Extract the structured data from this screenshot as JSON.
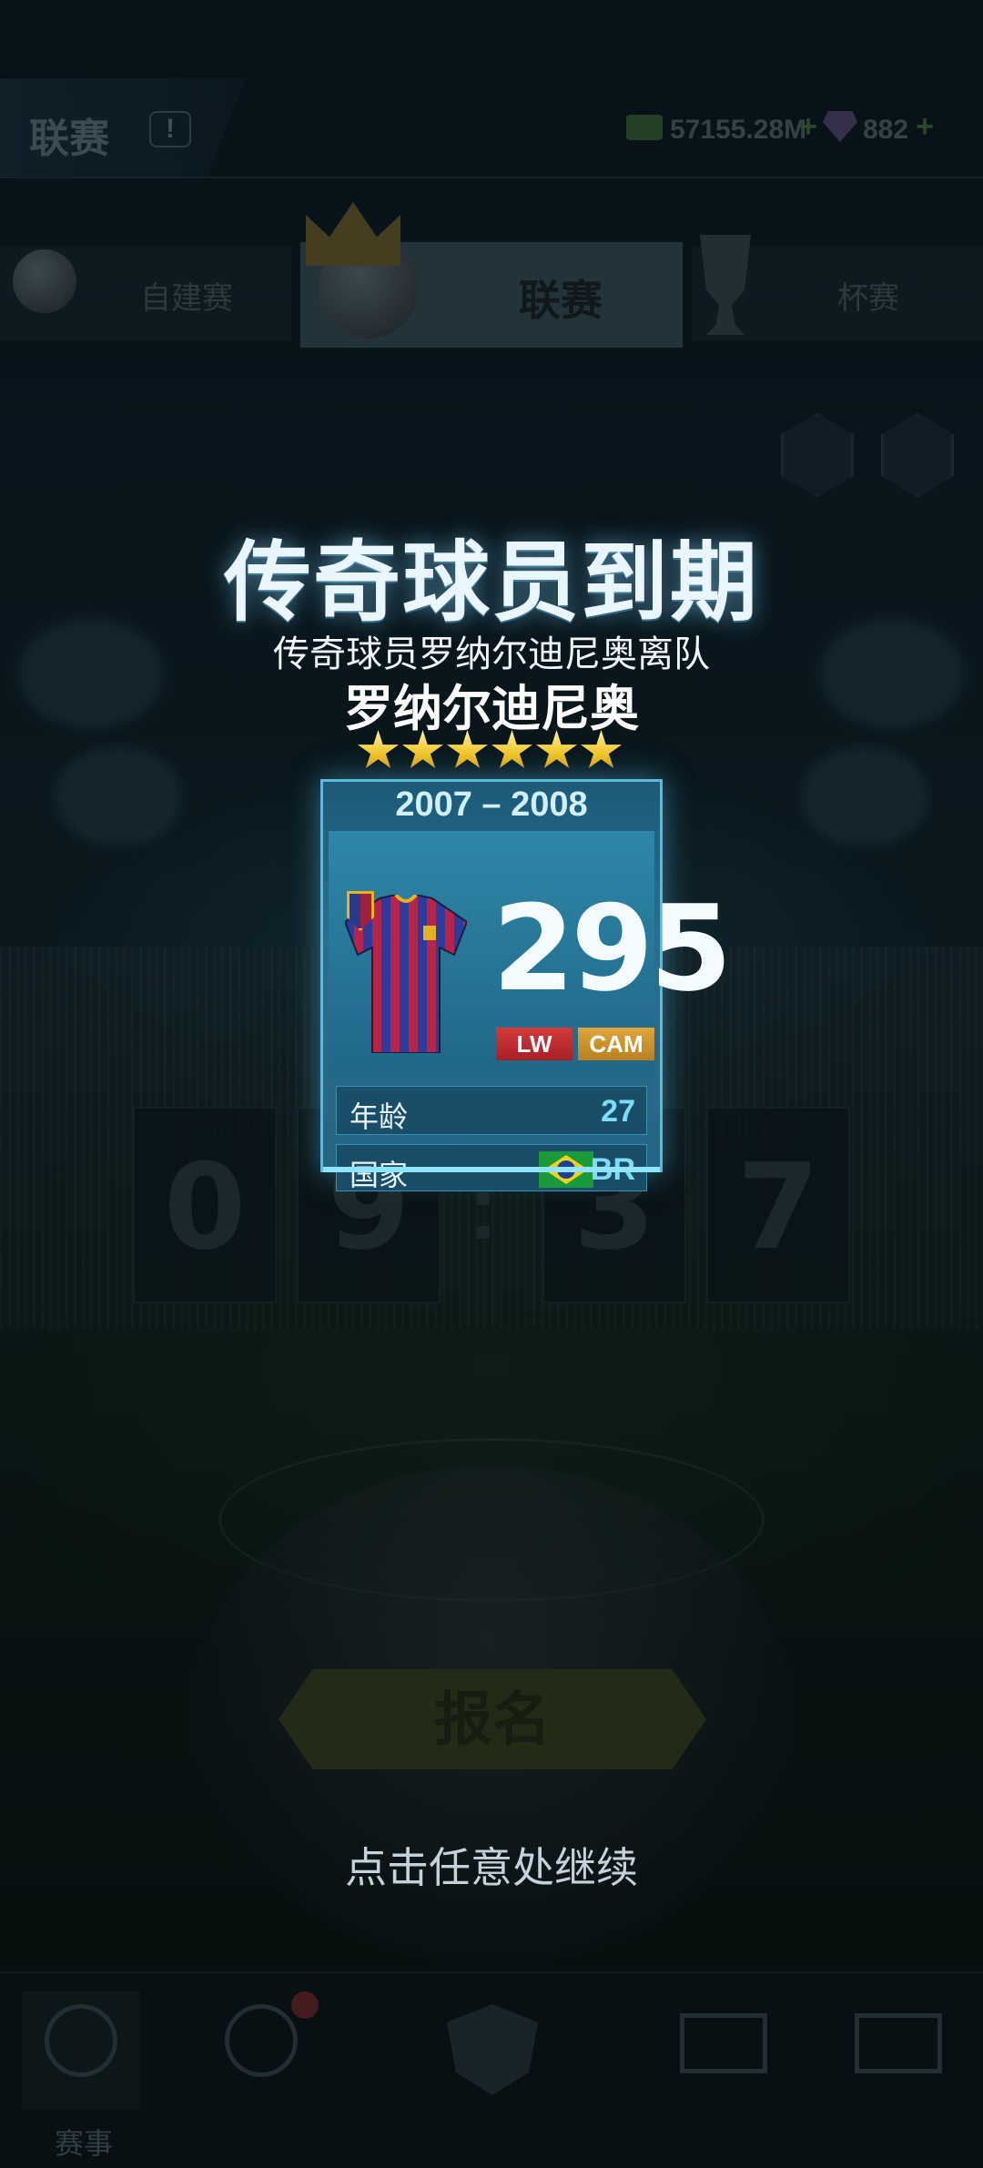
{
  "header": {
    "title": "联赛",
    "info_label": "!",
    "cash": "57155.28M",
    "gems": "882"
  },
  "mode_tabs": [
    {
      "label": "自建赛"
    },
    {
      "label": "联赛"
    },
    {
      "label": "杯赛"
    }
  ],
  "countdown": {
    "digits": [
      "0",
      "9",
      "3",
      "7"
    ],
    "separator": ":"
  },
  "signup_button": "报名",
  "bottom_nav": {
    "items": [
      {
        "label": "赛事"
      }
    ]
  },
  "popup": {
    "title": "传奇球员到期",
    "subtitle": "传奇球员罗纳尔迪尼奥离队",
    "player_name": "罗纳尔迪尼奥",
    "stars": 6,
    "season": "2007 – 2008",
    "rating": "295",
    "positions": [
      "LW",
      "CAM"
    ],
    "age_label": "年龄",
    "age": "27",
    "nation_label": "国家",
    "nation": "BR",
    "continue_text": "点击任意处继续"
  },
  "colors": {
    "accent_glow": "#5fb8dc",
    "star": "#f2c322",
    "pos_lw": "#c42e32",
    "pos_cam": "#d09530"
  }
}
